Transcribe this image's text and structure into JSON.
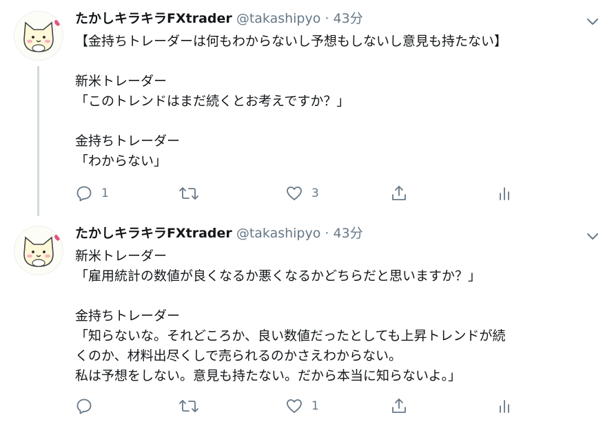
{
  "tweets": [
    {
      "name": "たかしキラキラFXtrader",
      "handle": "@takashipyo",
      "separator": "·",
      "time": "43分",
      "text": "【金持ちトレーダーは何もわからないし予想もしないし意見も持たない】\n\n新米トレーダー\n「このトレンドはまだ続くとお考えですか？」\n\n金持ちトレーダー\n「わからない」",
      "counts": {
        "reply": "1",
        "retweet": "",
        "like": "3"
      }
    },
    {
      "name": "たかしキラキラFXtrader",
      "handle": "@takashipyo",
      "separator": "·",
      "time": "43分",
      "text": "新米トレーダー\n「雇用統計の数値が良くなるか悪くなるかどちらだと思いますか？」\n\n金持ちトレーダー\n「知らないな。それどころか、良い数値だったとしても上昇トレンドが続\nくのか、材料出尽くしで売られるのかさえわからない。\n私は予想をしない。意見も持たない。だから本当に知らないよ。」",
      "counts": {
        "reply": "",
        "retweet": "",
        "like": "1"
      }
    }
  ],
  "icons": {
    "avatar": "cat-avatar-icon",
    "caret": "chevron-down-icon",
    "reply": "reply-icon",
    "retweet": "retweet-icon",
    "like": "heart-icon",
    "share": "share-icon",
    "analytics": "analytics-icon"
  },
  "colors": {
    "text": "#14171a",
    "muted": "#657786",
    "thread": "#cfd9de"
  }
}
